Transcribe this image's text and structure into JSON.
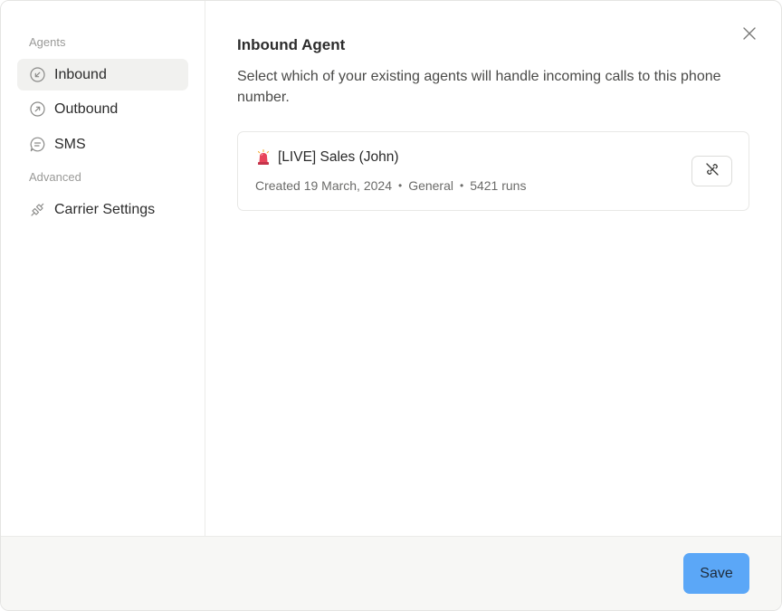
{
  "sidebar": {
    "agents_label": "Agents",
    "advanced_label": "Advanced",
    "items": [
      {
        "label": "Inbound",
        "icon": "arrow-down-left-circle-icon",
        "active": true
      },
      {
        "label": "Outbound",
        "icon": "arrow-up-right-circle-icon",
        "active": false
      },
      {
        "label": "SMS",
        "icon": "message-circle-icon",
        "active": false
      }
    ],
    "advanced_items": [
      {
        "label": "Carrier Settings",
        "icon": "plug-icon"
      }
    ]
  },
  "main": {
    "title": "Inbound Agent",
    "description": "Select which of your existing agents will handle incoming calls to this phone number.",
    "agent": {
      "name": "[LIVE] Sales (John)",
      "emoji_icon": "siren-light-icon",
      "created": "Created 19 March, 2024",
      "category": "General",
      "runs": "5421 runs"
    }
  },
  "footer": {
    "save_label": "Save"
  },
  "colors": {
    "accent": "#5ba7f7",
    "active_bg": "#f1f1ef",
    "footer_bg": "#f7f7f5"
  }
}
